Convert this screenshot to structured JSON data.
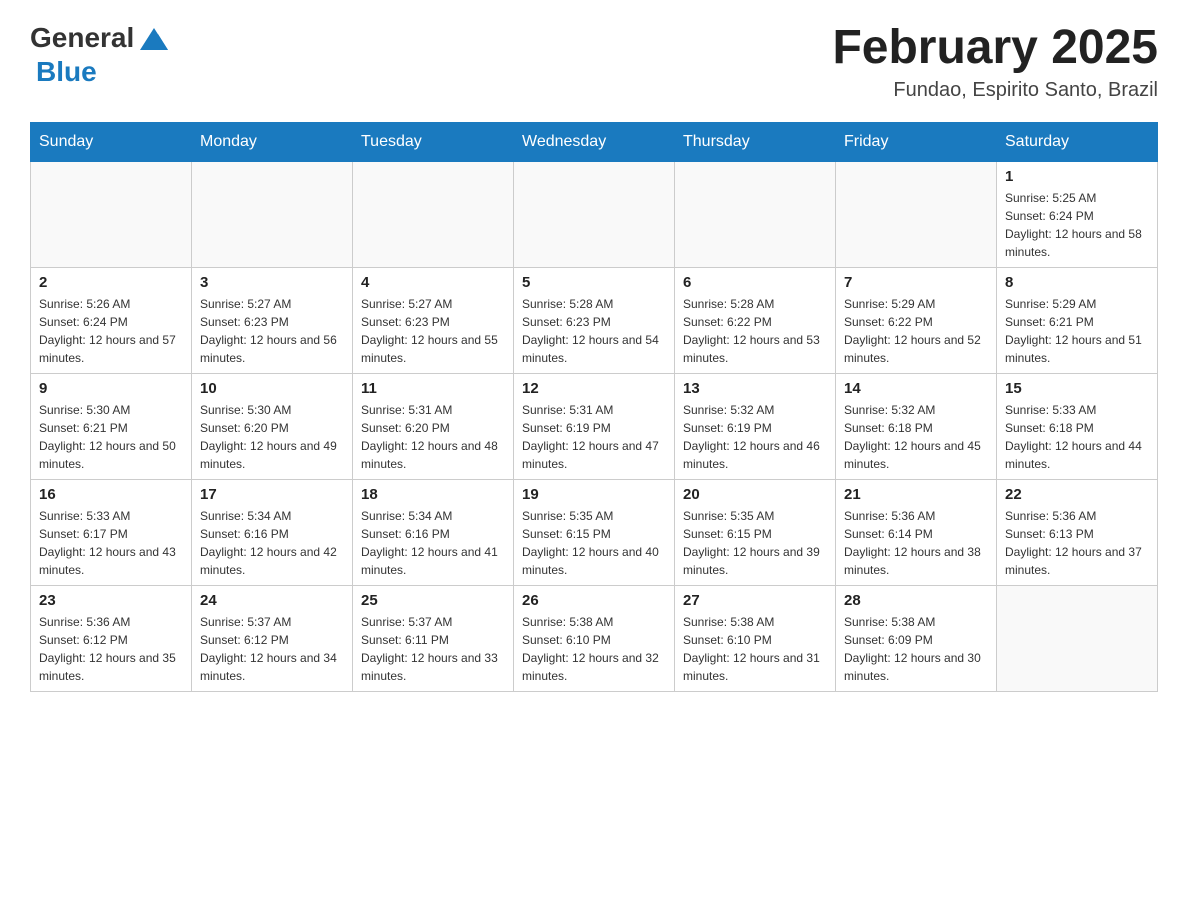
{
  "header": {
    "logo_general": "General",
    "logo_blue": "Blue",
    "title": "February 2025",
    "subtitle": "Fundao, Espirito Santo, Brazil"
  },
  "days_of_week": [
    "Sunday",
    "Monday",
    "Tuesday",
    "Wednesday",
    "Thursday",
    "Friday",
    "Saturday"
  ],
  "weeks": [
    [
      {
        "day": "",
        "info": ""
      },
      {
        "day": "",
        "info": ""
      },
      {
        "day": "",
        "info": ""
      },
      {
        "day": "",
        "info": ""
      },
      {
        "day": "",
        "info": ""
      },
      {
        "day": "",
        "info": ""
      },
      {
        "day": "1",
        "info": "Sunrise: 5:25 AM\nSunset: 6:24 PM\nDaylight: 12 hours and 58 minutes."
      }
    ],
    [
      {
        "day": "2",
        "info": "Sunrise: 5:26 AM\nSunset: 6:24 PM\nDaylight: 12 hours and 57 minutes."
      },
      {
        "day": "3",
        "info": "Sunrise: 5:27 AM\nSunset: 6:23 PM\nDaylight: 12 hours and 56 minutes."
      },
      {
        "day": "4",
        "info": "Sunrise: 5:27 AM\nSunset: 6:23 PM\nDaylight: 12 hours and 55 minutes."
      },
      {
        "day": "5",
        "info": "Sunrise: 5:28 AM\nSunset: 6:23 PM\nDaylight: 12 hours and 54 minutes."
      },
      {
        "day": "6",
        "info": "Sunrise: 5:28 AM\nSunset: 6:22 PM\nDaylight: 12 hours and 53 minutes."
      },
      {
        "day": "7",
        "info": "Sunrise: 5:29 AM\nSunset: 6:22 PM\nDaylight: 12 hours and 52 minutes."
      },
      {
        "day": "8",
        "info": "Sunrise: 5:29 AM\nSunset: 6:21 PM\nDaylight: 12 hours and 51 minutes."
      }
    ],
    [
      {
        "day": "9",
        "info": "Sunrise: 5:30 AM\nSunset: 6:21 PM\nDaylight: 12 hours and 50 minutes."
      },
      {
        "day": "10",
        "info": "Sunrise: 5:30 AM\nSunset: 6:20 PM\nDaylight: 12 hours and 49 minutes."
      },
      {
        "day": "11",
        "info": "Sunrise: 5:31 AM\nSunset: 6:20 PM\nDaylight: 12 hours and 48 minutes."
      },
      {
        "day": "12",
        "info": "Sunrise: 5:31 AM\nSunset: 6:19 PM\nDaylight: 12 hours and 47 minutes."
      },
      {
        "day": "13",
        "info": "Sunrise: 5:32 AM\nSunset: 6:19 PM\nDaylight: 12 hours and 46 minutes."
      },
      {
        "day": "14",
        "info": "Sunrise: 5:32 AM\nSunset: 6:18 PM\nDaylight: 12 hours and 45 minutes."
      },
      {
        "day": "15",
        "info": "Sunrise: 5:33 AM\nSunset: 6:18 PM\nDaylight: 12 hours and 44 minutes."
      }
    ],
    [
      {
        "day": "16",
        "info": "Sunrise: 5:33 AM\nSunset: 6:17 PM\nDaylight: 12 hours and 43 minutes."
      },
      {
        "day": "17",
        "info": "Sunrise: 5:34 AM\nSunset: 6:16 PM\nDaylight: 12 hours and 42 minutes."
      },
      {
        "day": "18",
        "info": "Sunrise: 5:34 AM\nSunset: 6:16 PM\nDaylight: 12 hours and 41 minutes."
      },
      {
        "day": "19",
        "info": "Sunrise: 5:35 AM\nSunset: 6:15 PM\nDaylight: 12 hours and 40 minutes."
      },
      {
        "day": "20",
        "info": "Sunrise: 5:35 AM\nSunset: 6:15 PM\nDaylight: 12 hours and 39 minutes."
      },
      {
        "day": "21",
        "info": "Sunrise: 5:36 AM\nSunset: 6:14 PM\nDaylight: 12 hours and 38 minutes."
      },
      {
        "day": "22",
        "info": "Sunrise: 5:36 AM\nSunset: 6:13 PM\nDaylight: 12 hours and 37 minutes."
      }
    ],
    [
      {
        "day": "23",
        "info": "Sunrise: 5:36 AM\nSunset: 6:12 PM\nDaylight: 12 hours and 35 minutes."
      },
      {
        "day": "24",
        "info": "Sunrise: 5:37 AM\nSunset: 6:12 PM\nDaylight: 12 hours and 34 minutes."
      },
      {
        "day": "25",
        "info": "Sunrise: 5:37 AM\nSunset: 6:11 PM\nDaylight: 12 hours and 33 minutes."
      },
      {
        "day": "26",
        "info": "Sunrise: 5:38 AM\nSunset: 6:10 PM\nDaylight: 12 hours and 32 minutes."
      },
      {
        "day": "27",
        "info": "Sunrise: 5:38 AM\nSunset: 6:10 PM\nDaylight: 12 hours and 31 minutes."
      },
      {
        "day": "28",
        "info": "Sunrise: 5:38 AM\nSunset: 6:09 PM\nDaylight: 12 hours and 30 minutes."
      },
      {
        "day": "",
        "info": ""
      }
    ]
  ]
}
